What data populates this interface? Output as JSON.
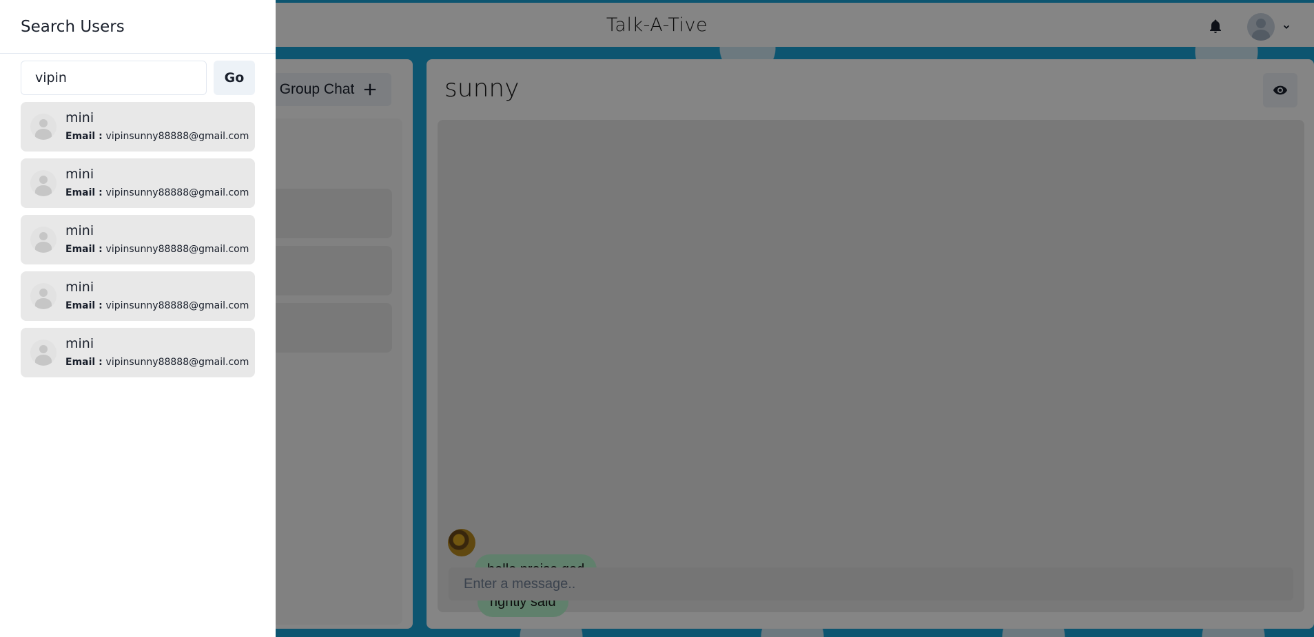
{
  "header": {
    "app_title": "Talk-A-Tive",
    "bell_icon": "bell-icon",
    "avatar_icon": "user-avatar-icon",
    "menu_icon": "chevron-down-icon"
  },
  "my_chats": {
    "new_group_button": "New Group Chat",
    "new_group_visible_label": "Group Chat",
    "items": [
      {},
      {},
      {}
    ]
  },
  "chat": {
    "name": "sunny",
    "view_icon": "eye-icon",
    "messages": [
      {
        "text": "hello praise god"
      },
      {
        "text": "rightly said"
      }
    ],
    "input_placeholder": "Enter a message.."
  },
  "drawer": {
    "title": "Search Users",
    "search_value": "vipin",
    "go_label": "Go",
    "email_label": "Email : ",
    "results": [
      {
        "name": "mini",
        "email": "vipinsunny88888@gmail.com"
      },
      {
        "name": "mini",
        "email": "vipinsunny88888@gmail.com"
      },
      {
        "name": "mini",
        "email": "vipinsunny88888@gmail.com"
      },
      {
        "name": "mini",
        "email": "vipinsunny88888@gmail.com"
      },
      {
        "name": "mini",
        "email": "vipinsunny88888@gmail.com"
      }
    ]
  },
  "colors": {
    "accent_background": "#1aa3d6",
    "message_bubble": "#b9f5d0",
    "overlay": "rgba(0,0,0,0.48)"
  }
}
